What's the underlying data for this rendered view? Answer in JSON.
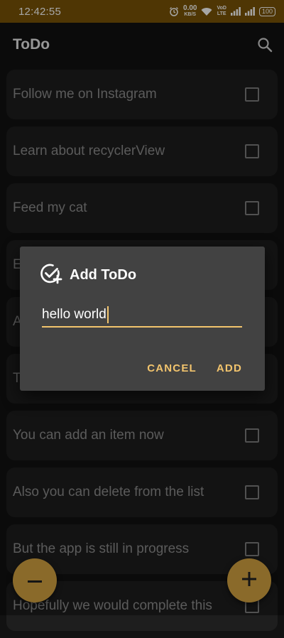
{
  "status_bar": {
    "time": "12:42:55",
    "speed": "0.00",
    "speed_unit": "KB/S",
    "network_tag_top": "VoD",
    "network_tag_bottom": "LTE",
    "battery": "100"
  },
  "app_bar": {
    "title": "ToDo",
    "search_icon": "search-icon"
  },
  "todo_items": [
    {
      "text": "Follow me on Instagram",
      "checked": false
    },
    {
      "text": "Learn about recyclerView",
      "checked": false
    },
    {
      "text": "Feed my cat",
      "checked": false
    },
    {
      "text": "E",
      "checked": false
    },
    {
      "text": "A",
      "checked": false
    },
    {
      "text": "T",
      "checked": false
    },
    {
      "text": "You can add an item now",
      "checked": false
    },
    {
      "text": "Also you can delete from the list",
      "checked": false
    },
    {
      "text": "But the app is still in progress",
      "checked": false
    },
    {
      "text": "Hopefully we would complete this",
      "checked": false
    }
  ],
  "dialog": {
    "title": "Add ToDo",
    "icon": "add-task-icon",
    "input_value": "hello world",
    "cancel_label": "CANCEL",
    "add_label": "ADD"
  },
  "fabs": {
    "left_icon": "minus-icon",
    "right_icon": "plus-icon"
  },
  "colors": {
    "status_bar": "#7a5407",
    "accent": "#f2c46d",
    "fab": "#8a6a2a",
    "background": "#121212",
    "card": "#1e1e1e",
    "dialog": "#424242"
  }
}
